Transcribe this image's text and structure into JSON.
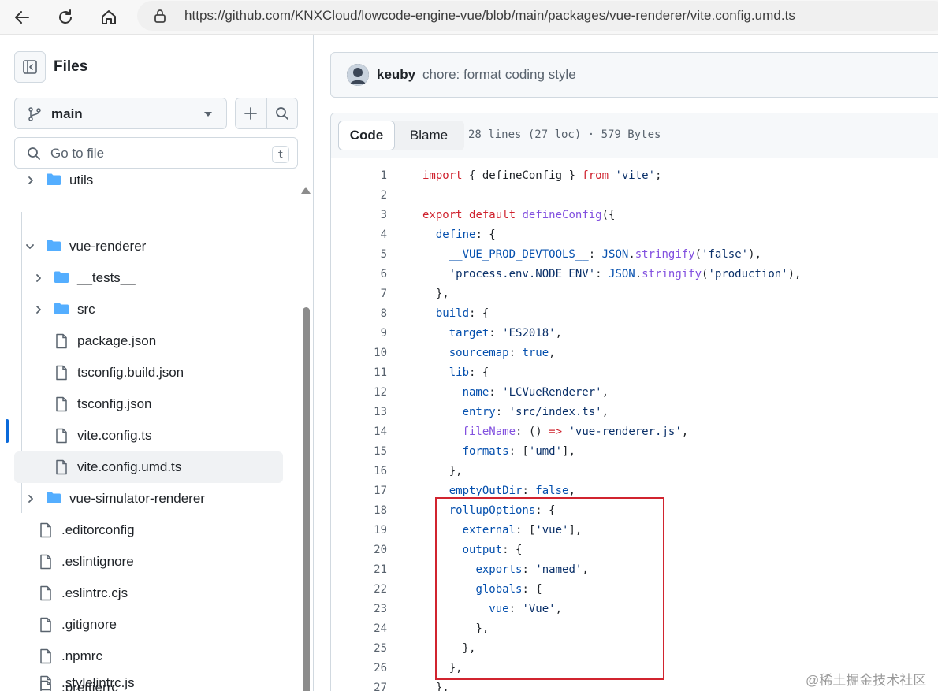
{
  "browser": {
    "url": "https://github.com/KNXCloud/lowcode-engine-vue/blob/main/packages/vue-renderer/vite.config.umd.ts"
  },
  "sidebar": {
    "title": "Files",
    "branch": "main",
    "goto_placeholder": "Go to file",
    "goto_shortcut": "t",
    "tree": [
      {
        "label": "utils",
        "type": "folder"
      },
      {
        "label": "vue-renderer",
        "type": "folder"
      },
      {
        "label": "__tests__",
        "type": "folder"
      },
      {
        "label": "src",
        "type": "folder"
      },
      {
        "label": "package.json",
        "type": "file"
      },
      {
        "label": "tsconfig.build.json",
        "type": "file"
      },
      {
        "label": "tsconfig.json",
        "type": "file"
      },
      {
        "label": "vite.config.ts",
        "type": "file"
      },
      {
        "label": "vite.config.umd.ts",
        "type": "file",
        "selected": true
      },
      {
        "label": "vue-simulator-renderer",
        "type": "folder"
      },
      {
        "label": ".editorconfig",
        "type": "file"
      },
      {
        "label": ".eslintignore",
        "type": "file"
      },
      {
        "label": ".eslintrc.cjs",
        "type": "file"
      },
      {
        "label": ".gitignore",
        "type": "file"
      },
      {
        "label": ".npmrc",
        "type": "file"
      },
      {
        "label": ".prettierrc",
        "type": "file"
      },
      {
        "label": ".stylelintrc.js",
        "type": "file"
      }
    ]
  },
  "commit": {
    "author": "keuby",
    "message": "chore: format coding style"
  },
  "code_view": {
    "tab_code": "Code",
    "tab_blame": "Blame",
    "meta": "28 lines (27 loc) · 579 Bytes",
    "line_numbers": [
      "1",
      "2",
      "3",
      "4",
      "5",
      "6",
      "7",
      "8",
      "9",
      "10",
      "11",
      "12",
      "13",
      "14",
      "15",
      "16",
      "17",
      "18",
      "19",
      "20",
      "21",
      "22",
      "23",
      "24",
      "25",
      "26",
      "27"
    ],
    "lines": [
      [
        {
          "t": "import",
          "c": "kw"
        },
        {
          "t": " { defineConfig } "
        },
        {
          "t": "from",
          "c": "kw"
        },
        {
          "t": " "
        },
        {
          "t": "'vite'",
          "c": "str"
        },
        {
          "t": ";"
        }
      ],
      [],
      [
        {
          "t": "export",
          "c": "kw"
        },
        {
          "t": " "
        },
        {
          "t": "default",
          "c": "kw"
        },
        {
          "t": " "
        },
        {
          "t": "defineConfig",
          "c": "fn"
        },
        {
          "t": "({"
        }
      ],
      [
        {
          "t": "  "
        },
        {
          "t": "define",
          "c": "prop"
        },
        {
          "t": ": {"
        }
      ],
      [
        {
          "t": "    "
        },
        {
          "t": "__VUE_PROD_DEVTOOLS__",
          "c": "prop"
        },
        {
          "t": ": "
        },
        {
          "t": "JSON",
          "c": "cst"
        },
        {
          "t": "."
        },
        {
          "t": "stringify",
          "c": "fn"
        },
        {
          "t": "("
        },
        {
          "t": "'false'",
          "c": "str"
        },
        {
          "t": "),"
        }
      ],
      [
        {
          "t": "    "
        },
        {
          "t": "'process.env.NODE_ENV'",
          "c": "str"
        },
        {
          "t": ": "
        },
        {
          "t": "JSON",
          "c": "cst"
        },
        {
          "t": "."
        },
        {
          "t": "stringify",
          "c": "fn"
        },
        {
          "t": "("
        },
        {
          "t": "'production'",
          "c": "str"
        },
        {
          "t": "),"
        }
      ],
      [
        {
          "t": "  },"
        }
      ],
      [
        {
          "t": "  "
        },
        {
          "t": "build",
          "c": "prop"
        },
        {
          "t": ": {"
        }
      ],
      [
        {
          "t": "    "
        },
        {
          "t": "target",
          "c": "prop"
        },
        {
          "t": ": "
        },
        {
          "t": "'ES2018'",
          "c": "str"
        },
        {
          "t": ","
        }
      ],
      [
        {
          "t": "    "
        },
        {
          "t": "sourcemap",
          "c": "prop"
        },
        {
          "t": ": "
        },
        {
          "t": "true",
          "c": "cst"
        },
        {
          "t": ","
        }
      ],
      [
        {
          "t": "    "
        },
        {
          "t": "lib",
          "c": "prop"
        },
        {
          "t": ": {"
        }
      ],
      [
        {
          "t": "      "
        },
        {
          "t": "name",
          "c": "prop"
        },
        {
          "t": ": "
        },
        {
          "t": "'LCVueRenderer'",
          "c": "str"
        },
        {
          "t": ","
        }
      ],
      [
        {
          "t": "      "
        },
        {
          "t": "entry",
          "c": "prop"
        },
        {
          "t": ": "
        },
        {
          "t": "'src/index.ts'",
          "c": "str"
        },
        {
          "t": ","
        }
      ],
      [
        {
          "t": "      "
        },
        {
          "t": "fileName",
          "c": "fn"
        },
        {
          "t": ": () "
        },
        {
          "t": "=>",
          "c": "kw"
        },
        {
          "t": " "
        },
        {
          "t": "'vue-renderer.js'",
          "c": "str"
        },
        {
          "t": ","
        }
      ],
      [
        {
          "t": "      "
        },
        {
          "t": "formats",
          "c": "prop"
        },
        {
          "t": ": ["
        },
        {
          "t": "'umd'",
          "c": "str"
        },
        {
          "t": "],"
        }
      ],
      [
        {
          "t": "    },"
        }
      ],
      [
        {
          "t": "    "
        },
        {
          "t": "emptyOutDir",
          "c": "prop"
        },
        {
          "t": ": "
        },
        {
          "t": "false",
          "c": "cst"
        },
        {
          "t": ","
        }
      ],
      [
        {
          "t": "    "
        },
        {
          "t": "rollupOptions",
          "c": "prop"
        },
        {
          "t": ": {"
        }
      ],
      [
        {
          "t": "      "
        },
        {
          "t": "external",
          "c": "prop"
        },
        {
          "t": ": ["
        },
        {
          "t": "'vue'",
          "c": "str"
        },
        {
          "t": "],"
        }
      ],
      [
        {
          "t": "      "
        },
        {
          "t": "output",
          "c": "prop"
        },
        {
          "t": ": {"
        }
      ],
      [
        {
          "t": "        "
        },
        {
          "t": "exports",
          "c": "prop"
        },
        {
          "t": ": "
        },
        {
          "t": "'named'",
          "c": "str"
        },
        {
          "t": ","
        }
      ],
      [
        {
          "t": "        "
        },
        {
          "t": "globals",
          "c": "prop"
        },
        {
          "t": ": {"
        }
      ],
      [
        {
          "t": "          "
        },
        {
          "t": "vue",
          "c": "prop"
        },
        {
          "t": ": "
        },
        {
          "t": "'Vue'",
          "c": "str"
        },
        {
          "t": ","
        }
      ],
      [
        {
          "t": "        },"
        }
      ],
      [
        {
          "t": "      },"
        }
      ],
      [
        {
          "t": "    },"
        }
      ],
      [
        {
          "t": "  },"
        }
      ]
    ]
  },
  "watermark": "@稀土掘金技术社区",
  "colors": {
    "accent": "#0969da",
    "folder": "#54aeff",
    "highlight_border": "#d1242f"
  }
}
